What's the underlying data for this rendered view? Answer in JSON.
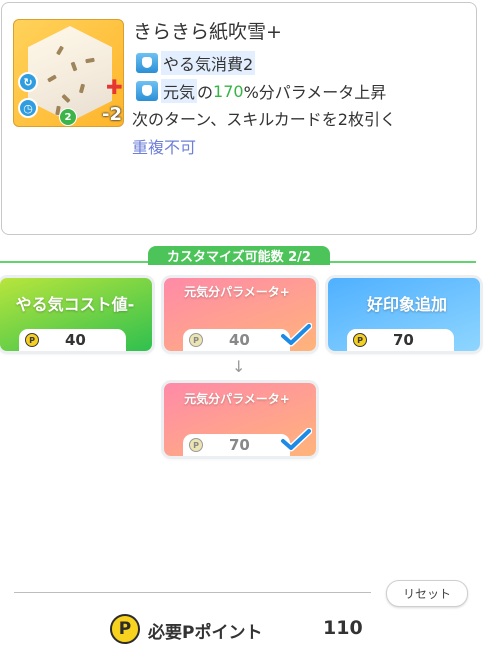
{
  "card": {
    "title": "きらきら紙吹雪+",
    "cost_badge": "-2",
    "art_level": "2",
    "rarity": "A",
    "effect1": "やる気消費2",
    "effect2_pre": "元気",
    "effect2_mid": "の",
    "effect2_pct": "170",
    "effect2_post": "%分パラメータ上昇",
    "line3": "次のターン、スキルカードを2枚引く",
    "note": "重複不可"
  },
  "customize": {
    "header": "カスタマイズ可能数 2/2",
    "options": [
      {
        "label": "やる気コスト値-",
        "cost": "40",
        "color_from": "#a9dd3b",
        "color_to": "#33c64f",
        "selected": false
      },
      {
        "label": "元気分パラメータ+",
        "cost": "40",
        "color_from": "#ff8aa8",
        "color_to": "#ffb177",
        "selected": true
      },
      {
        "label": "好印象追加",
        "cost": "70",
        "color_from": "#5ab7ff",
        "color_to": "#8dd4ff",
        "selected": false
      }
    ],
    "next_option": {
      "label": "元気分パラメータ+",
      "cost": "70",
      "selected": true
    }
  },
  "footer": {
    "reset_label": "リセット",
    "coin_symbol": "P",
    "points_label": "必要Pポイント",
    "points_value": "110"
  }
}
